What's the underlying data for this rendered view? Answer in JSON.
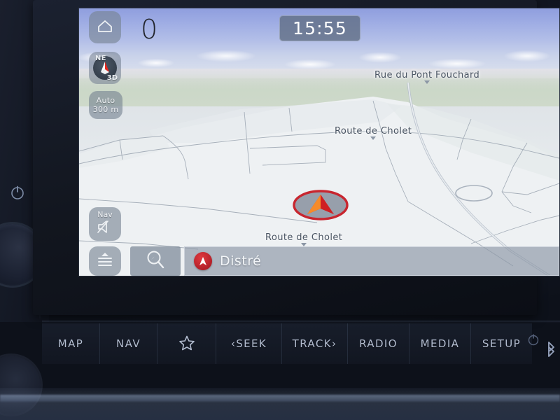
{
  "device": {
    "type": "car-infotainment-head-unit",
    "colors": {
      "accent_red": "#c8262f",
      "overlay_gray": "#7682926f",
      "button_text": "#b3bdd0",
      "sky_blue": "#9fadE4",
      "terrain_green": "#c9d6c6",
      "map_white": "#eceff1",
      "clock_bg": "#606e85"
    }
  },
  "screen": {
    "status": {
      "clock": "15:55",
      "speed_value": "0"
    },
    "overlay_buttons": {
      "home": {
        "icon": "home-icon",
        "label": ""
      },
      "compass": {
        "heading": "NE",
        "view_mode": "3D",
        "icon": "compass-icon"
      },
      "scale": {
        "mode": "Auto",
        "distance": "300 m"
      },
      "nav_mute": {
        "label": "Nav",
        "icon": "speaker-mute-icon"
      },
      "menu": {
        "icon": "menu-expand-icon"
      },
      "search": {
        "icon": "search-nav-icon"
      }
    },
    "destination_bar": {
      "badge_icon": "position-arrow-icon",
      "name": "Distré"
    },
    "map": {
      "vehicle_marker": "vehicle-position-arrow",
      "labels": [
        {
          "text": "Rue du Pont Fouchard"
        },
        {
          "text": "Route de Cholet"
        },
        {
          "text": "Route de Cholet"
        }
      ]
    }
  },
  "hardware_buttons": [
    {
      "id": "map",
      "label": "MAP",
      "type": "text"
    },
    {
      "id": "nav",
      "label": "NAV",
      "type": "text"
    },
    {
      "id": "fav",
      "label": "",
      "type": "icon",
      "icon": "star-icon"
    },
    {
      "id": "seek",
      "label": "‹SEEK",
      "type": "text"
    },
    {
      "id": "track",
      "label": "TRACK›",
      "type": "text"
    },
    {
      "id": "radio",
      "label": "RADIO",
      "type": "text"
    },
    {
      "id": "media",
      "label": "MEDIA",
      "type": "text"
    },
    {
      "id": "setup",
      "label": "SETUP",
      "type": "text"
    }
  ],
  "dashboard": {
    "power_icon": "power-icon",
    "bluetooth_icon": "bluetooth-icon"
  }
}
